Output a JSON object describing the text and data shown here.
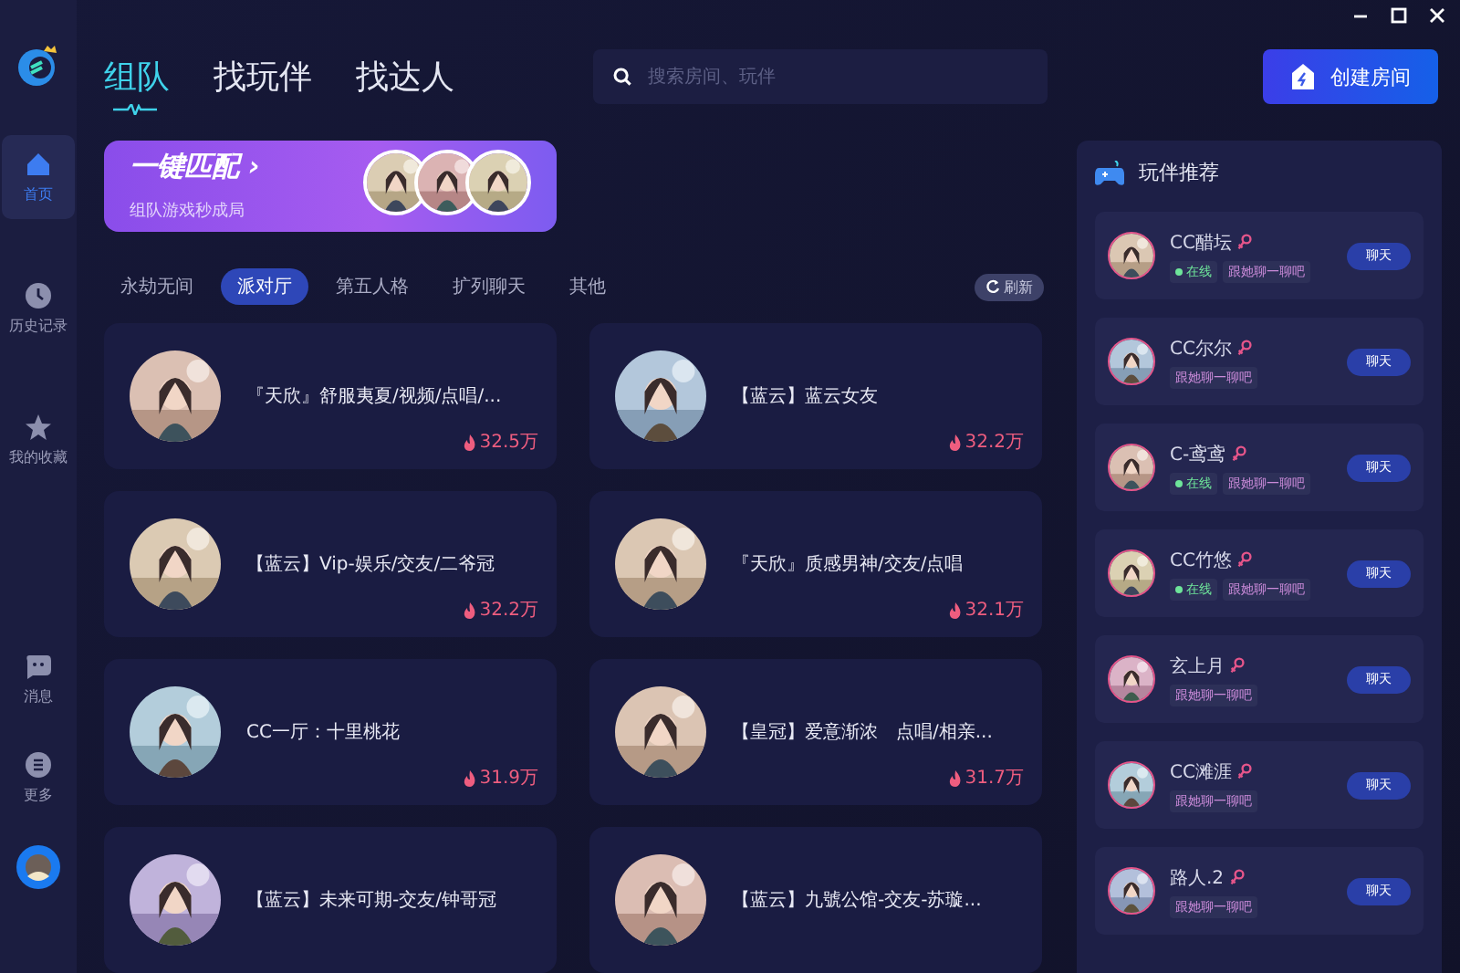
{
  "sidebar": {
    "items": [
      {
        "label": "首页",
        "kind": "home",
        "selected": true
      },
      {
        "label": "历史记录",
        "kind": "clock",
        "selected": false
      },
      {
        "label": "我的收藏",
        "kind": "star",
        "selected": false
      }
    ],
    "bottom_items": [
      {
        "label": "消息",
        "kind": "chat",
        "selected": false
      },
      {
        "label": "更多",
        "kind": "more",
        "selected": false
      }
    ]
  },
  "header": {
    "tabs": [
      {
        "label": "组队",
        "selected": true
      },
      {
        "label": "找玩伴",
        "selected": false
      },
      {
        "label": "找达人",
        "selected": false
      }
    ],
    "search": {
      "placeholder": "搜索房间、玩伴"
    },
    "create_button": "创建房间"
  },
  "banner": {
    "title": "一键匹配",
    "arrow": "›",
    "subtitle": "组队游戏秒成局"
  },
  "categories": [
    {
      "label": "永劫无间",
      "selected": false
    },
    {
      "label": "派对厅",
      "selected": true
    },
    {
      "label": "第五人格",
      "selected": false
    },
    {
      "label": "扩列聊天",
      "selected": false
    },
    {
      "label": "其他",
      "selected": false
    }
  ],
  "refresh_button": "刷新",
  "rooms": [
    {
      "title": "『天欣』舒服夷夏/视频/点唱/...",
      "heat": "32.5万"
    },
    {
      "title": "【蓝云】蓝云女友",
      "heat": "32.2万"
    },
    {
      "title": "【蓝云】Vip-娱乐/交友/二爷冠",
      "heat": "32.2万"
    },
    {
      "title": "『天欣』质感男神/交友/点唱",
      "heat": "32.1万"
    },
    {
      "title": "CC一厅：十里桃花",
      "heat": "31.9万"
    },
    {
      "title": "【皇冠】爱意渐浓　点唱/相亲...",
      "heat": "31.7万"
    },
    {
      "title": "【蓝云】未来可期-交友/钟哥冠"
    },
    {
      "title": "【蓝云】九號公馆-交友-苏璇..."
    }
  ],
  "recommend": {
    "title": "玩伴推荐",
    "players": [
      {
        "name": "CC醋坛",
        "online": true,
        "status": "在线",
        "tag": "跟她聊一聊吧",
        "button": "聊天"
      },
      {
        "name": "CC尔尔",
        "online": false,
        "tag": "跟她聊一聊吧",
        "button": "聊天"
      },
      {
        "name": "C-鸢鸢",
        "online": true,
        "status": "在线",
        "tag": "跟她聊一聊吧",
        "button": "聊天"
      },
      {
        "name": "CC竹悠",
        "online": true,
        "status": "在线",
        "tag": "跟她聊一聊吧",
        "button": "聊天"
      },
      {
        "name": "玄上月",
        "online": false,
        "tag": "跟她聊一聊吧",
        "button": "聊天"
      },
      {
        "name": "CC滩涯",
        "online": false,
        "tag": "跟她聊一聊吧",
        "button": "聊天"
      },
      {
        "name": "路人.2",
        "online": false,
        "tag": "跟她聊一聊吧",
        "button": "聊天"
      }
    ]
  }
}
